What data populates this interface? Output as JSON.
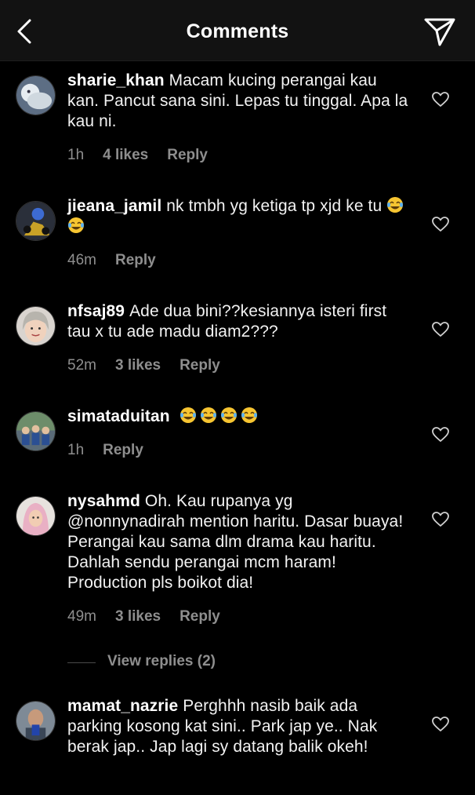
{
  "header": {
    "title": "Comments",
    "back_icon": "chevron-left-icon",
    "share_icon": "paper-plane-icon"
  },
  "colors": {
    "background": "#000000",
    "header": "#121212",
    "muted_text": "#8e8e8e"
  },
  "comments": [
    {
      "username": "sharie_khan",
      "text": "Macam kucing perangai kau kan. Pancut sana sini. Lepas tu tinggal. Apa la kau ni.",
      "time": "1h",
      "likes": "4 likes",
      "reply": "Reply"
    },
    {
      "username": "jieana_jamil",
      "text": "nk tmbh yg ketiga tp xjd ke tu",
      "emoji": [
        "face-with-tears-of-joy",
        "face-with-tears-of-joy"
      ],
      "time": "46m",
      "likes": "",
      "reply": "Reply"
    },
    {
      "username": "nfsaj89",
      "text": "Ade dua bini??kesiannya isteri first tau x tu ade madu diam2???",
      "time": "52m",
      "likes": "3 likes",
      "reply": "Reply"
    },
    {
      "username": "simataduitan",
      "text": "",
      "emoji": [
        "face-with-tears-of-joy",
        "face-with-tears-of-joy",
        "face-with-tears-of-joy",
        "face-with-tears-of-joy"
      ],
      "time": "1h",
      "likes": "",
      "reply": "Reply"
    },
    {
      "username": "nysahmd",
      "text": "Oh. Kau rupanya yg @nonnynadirah mention haritu. Dasar buaya! Perangai kau sama dlm drama kau haritu. Dahlah sendu perangai mcm haram! Production pls boikot dia!",
      "time": "49m",
      "likes": "3 likes",
      "reply": "Reply"
    },
    {
      "username": "mamat_nazrie",
      "text": "Perghhh nasib baik ada parking kosong kat sini.. Park jap ye.. Nak berak jap.. Jap lagi sy datang balik okeh!",
      "time": "",
      "likes": "",
      "reply": ""
    }
  ],
  "view_replies": "View replies (2)"
}
